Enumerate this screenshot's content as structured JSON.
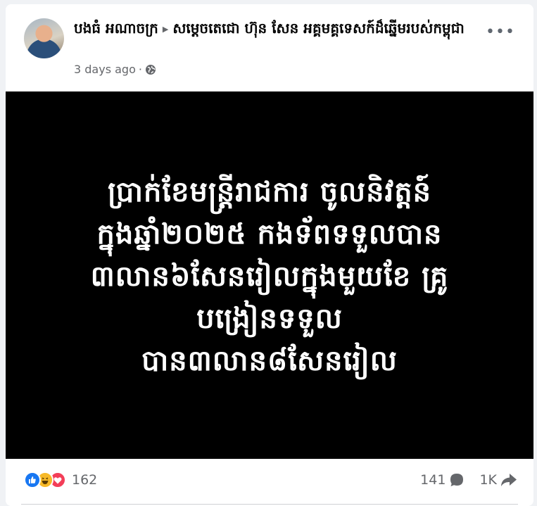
{
  "post": {
    "author": "បងធំ អណាចក្រ",
    "group": "សម្តេចតេជោ ហ៊ុន សែន អគ្គមគ្គទេសក៍ដ៏ឆ្នើមរបស់កម្ពុជា",
    "timestamp": "3 days ago",
    "separator": "·",
    "privacy_icon": "globe-icon",
    "more_icon": "more-options-icon",
    "image_text": "ប្រាក់ខែមន្ត្រីរាជការ ចូលនិវត្តន៍\nក្នុងឆ្នាំ២០២៥ កងទ័ពទទួលបាន\n៣លាន៦សែនរៀលក្នុងមួយខែ គ្រូ\nបង្រៀនទទួល\nបាន៣លាន៨សែនរៀល"
  },
  "reactions": {
    "types": [
      "like",
      "haha",
      "love"
    ],
    "count": "162"
  },
  "stats": {
    "comments": "141",
    "shares": "1K"
  },
  "colors": {
    "like": "#1877f2",
    "haha": "#f7b928",
    "love": "#f33e58",
    "image_bg": "#000000",
    "muted_text": "#65676b"
  }
}
